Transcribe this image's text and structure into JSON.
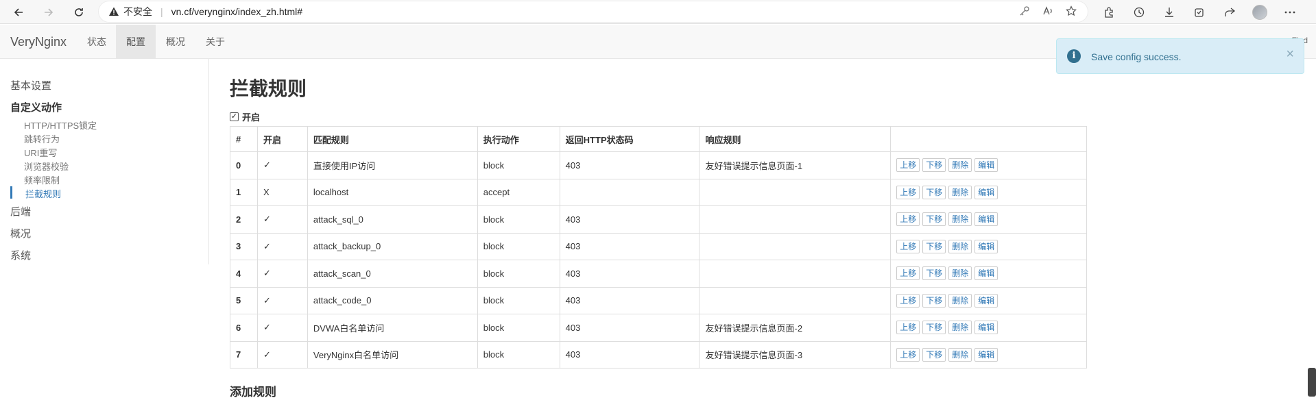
{
  "browser": {
    "insecure_label": "不安全",
    "url": "vn.cf/verynginx/index_zh.html#"
  },
  "app": {
    "brand": "VeryNginx",
    "nav": [
      {
        "label": "状态"
      },
      {
        "label": "配置"
      },
      {
        "label": "概况"
      },
      {
        "label": "关于"
      }
    ],
    "nav_right": "Find"
  },
  "sidebar": {
    "basic": "基本设置",
    "custom_action": "自定义动作",
    "sub_items": [
      {
        "label": "HTTP/HTTPS锁定"
      },
      {
        "label": "跳转行为"
      },
      {
        "label": "URI重写"
      },
      {
        "label": "浏览器校验"
      },
      {
        "label": "频率限制"
      },
      {
        "label": "拦截规则"
      }
    ],
    "backend": "后端",
    "overview": "概况",
    "system": "系统"
  },
  "main": {
    "title": "拦截规则",
    "enable_label": "开启",
    "add_rule_title": "添加规则"
  },
  "table": {
    "headers": [
      "#",
      "开启",
      "匹配规则",
      "执行动作",
      "返回HTTP状态码",
      "响应规则",
      ""
    ],
    "rows": [
      {
        "idx": "0",
        "enabled": "✓",
        "matcher": "直接使用IP访问",
        "action": "block",
        "code": "403",
        "response": "友好错误提示信息页面-1"
      },
      {
        "idx": "1",
        "enabled": "X",
        "matcher": "localhost",
        "action": "accept",
        "code": "",
        "response": ""
      },
      {
        "idx": "2",
        "enabled": "✓",
        "matcher": "attack_sql_0",
        "action": "block",
        "code": "403",
        "response": ""
      },
      {
        "idx": "3",
        "enabled": "✓",
        "matcher": "attack_backup_0",
        "action": "block",
        "code": "403",
        "response": ""
      },
      {
        "idx": "4",
        "enabled": "✓",
        "matcher": "attack_scan_0",
        "action": "block",
        "code": "403",
        "response": ""
      },
      {
        "idx": "5",
        "enabled": "✓",
        "matcher": "attack_code_0",
        "action": "block",
        "code": "403",
        "response": ""
      },
      {
        "idx": "6",
        "enabled": "✓",
        "matcher": "DVWA白名单访问",
        "action": "block",
        "code": "403",
        "response": "友好错误提示信息页面-2"
      },
      {
        "idx": "7",
        "enabled": "✓",
        "matcher": "VeryNginx白名单访问",
        "action": "block",
        "code": "403",
        "response": "友好错误提示信息页面-3"
      }
    ],
    "buttons": {
      "up": "上移",
      "down": "下移",
      "delete": "删除",
      "edit": "编辑"
    }
  },
  "toast": {
    "message": "Save config success.",
    "close": "×",
    "icon": "info-icon"
  },
  "colors": {
    "link": "#337ab7",
    "toast_bg": "#d9edf7",
    "toast_text": "#31708f",
    "active_nav_bg": "#e7e7e7"
  }
}
